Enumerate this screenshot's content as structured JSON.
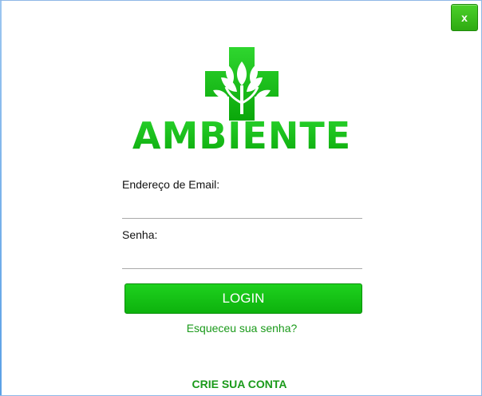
{
  "window": {
    "close_label": "x"
  },
  "logo": {
    "brand_text": "AMBIENTE",
    "icon": "medical-cross-leaf-icon",
    "brand_color": "#1cc21a"
  },
  "form": {
    "email_label": "Endereço de Email:",
    "email_value": "",
    "password_label": "Senha:",
    "password_value": ""
  },
  "actions": {
    "login_label": "LOGIN",
    "forgot_label": "Esqueceu sua senha?",
    "create_account_label": "CRIE SUA CONTA"
  },
  "colors": {
    "accent": "#12c012",
    "link": "#1a9a1a"
  }
}
